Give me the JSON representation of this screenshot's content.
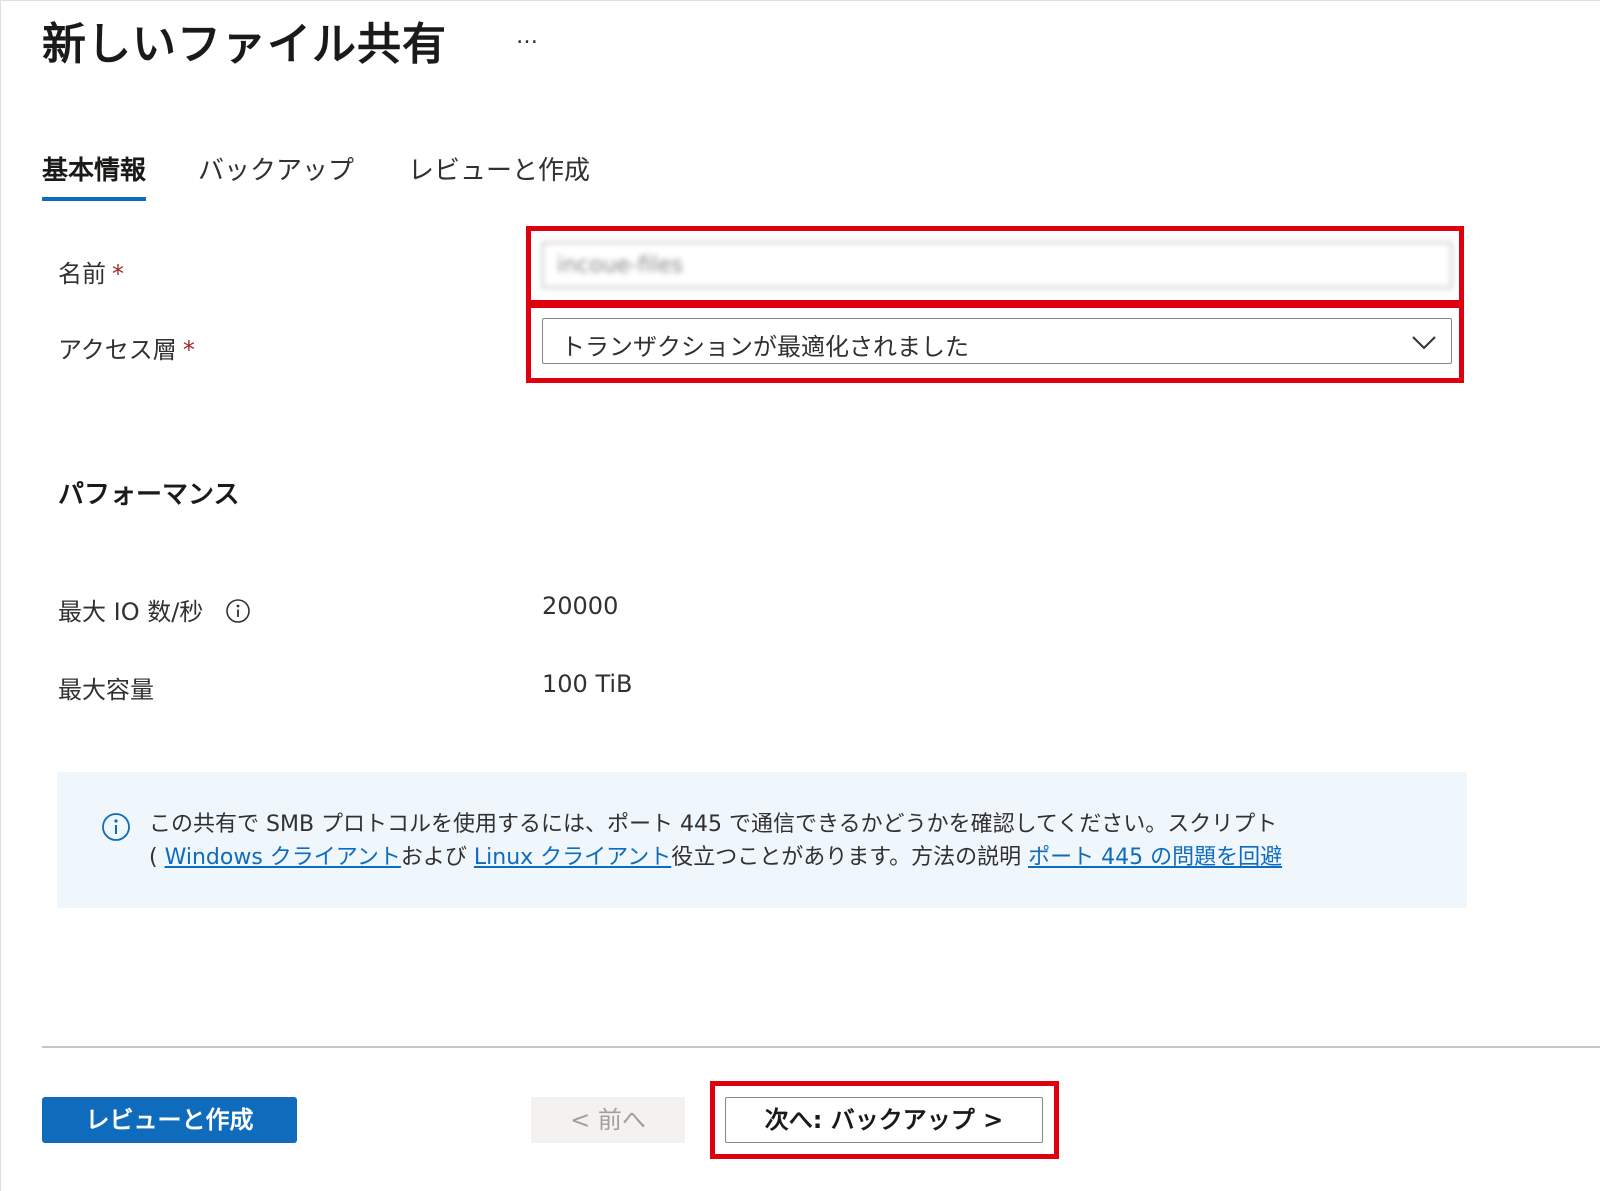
{
  "header": {
    "title": "新しいファイル共有",
    "more_label": "…"
  },
  "tabs": [
    {
      "label": "基本情報",
      "active": true
    },
    {
      "label": "バックアップ",
      "active": false
    },
    {
      "label": "レビューと作成",
      "active": false
    }
  ],
  "form": {
    "name_label": "名前",
    "name_required": "*",
    "name_value": "incoue-files",
    "tier_label": "アクセス層",
    "tier_required": "*",
    "tier_value": "トランザクションが最適化されました"
  },
  "performance": {
    "heading": "パフォーマンス",
    "max_iops_label": "最大 IO 数/秒",
    "max_iops_value": "20000",
    "max_capacity_label": "最大容量",
    "max_capacity_value": "100 TiB"
  },
  "banner": {
    "text_1": "この共有で SMB プロトコルを使用するには、ポート 445 で通信できるかどうかを確認してください。スクリプト",
    "text_2": "( ",
    "link_windows": "Windows クライアント",
    "text_3": "および ",
    "link_linux": "Linux クライアント",
    "text_4": "役立つことがあります。方法の説明 ",
    "link_port": "ポート 445 の問題を回避"
  },
  "footer": {
    "review_create_label": "レビューと作成",
    "prev_label": "< 前へ",
    "next_label": "次へ: バックアップ >"
  },
  "colors": {
    "accent": "#0f6cbd",
    "highlight": "#e0000d",
    "banner_bg": "#eff6fc",
    "required": "#a4262c"
  },
  "icons": {
    "tier_select": "chevron-down-icon",
    "iops_info": "info-circle-icon",
    "banner_info": "info-circle-icon"
  }
}
